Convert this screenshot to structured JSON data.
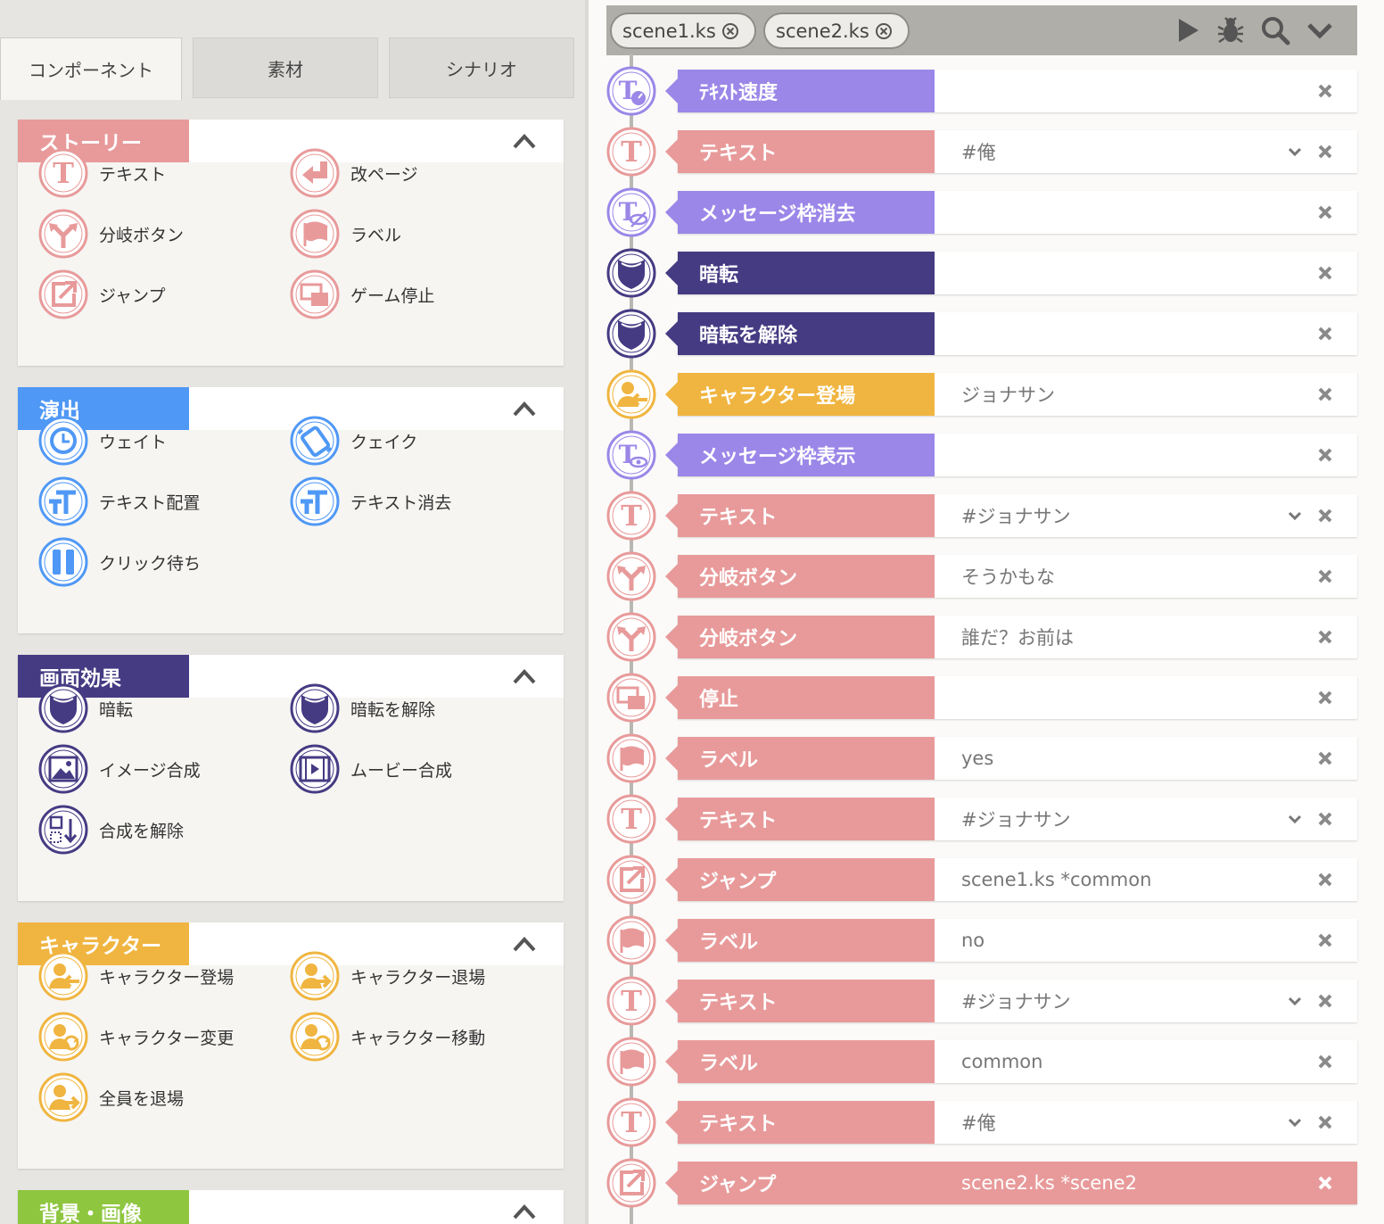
{
  "left_tabs": [
    "コンポーネント",
    "素材",
    "シナリオ"
  ],
  "panels": [
    {
      "title": "ストーリー",
      "color": "#e89a9a",
      "items": [
        {
          "label": "テキスト",
          "icon": "text-icon"
        },
        {
          "label": "改ページ",
          "icon": "return-icon"
        },
        {
          "label": "分岐ボタン",
          "icon": "branch-icon"
        },
        {
          "label": "ラベル",
          "icon": "flag-icon"
        },
        {
          "label": "ジャンプ",
          "icon": "jump-icon"
        },
        {
          "label": "ゲーム停止",
          "icon": "stop-icon"
        }
      ]
    },
    {
      "title": "演出",
      "color": "#4f98f5",
      "items": [
        {
          "label": "ウェイト",
          "icon": "clock-icon"
        },
        {
          "label": "クェイク",
          "icon": "quake-icon"
        },
        {
          "label": "テキスト配置",
          "icon": "text-position-icon"
        },
        {
          "label": "テキスト消去",
          "icon": "text-erase-icon"
        },
        {
          "label": "クリック待ち",
          "icon": "pause-icon"
        }
      ]
    },
    {
      "title": "画面効果",
      "color": "#453b83",
      "items": [
        {
          "label": "暗転",
          "icon": "fade-icon"
        },
        {
          "label": "暗転を解除",
          "icon": "fade-icon"
        },
        {
          "label": "イメージ合成",
          "icon": "image-icon"
        },
        {
          "label": "ムービー合成",
          "icon": "movie-icon"
        },
        {
          "label": "合成を解除",
          "icon": "clear-compose-icon"
        }
      ]
    },
    {
      "title": "キャラクター",
      "color": "#f0b540",
      "items": [
        {
          "label": "キャラクター登場",
          "icon": "character-enter-icon"
        },
        {
          "label": "キャラクター退場",
          "icon": "character-exit-icon"
        },
        {
          "label": "キャラクター変更",
          "icon": "character-change-icon"
        },
        {
          "label": "キャラクター移動",
          "icon": "character-move-icon"
        },
        {
          "label": "全員を退場",
          "icon": "character-exit-all-icon"
        }
      ]
    },
    {
      "title": "背景・画像",
      "color": "#8ec63f",
      "items": []
    }
  ],
  "file_tabs": [
    "scene1.ks",
    "scene2.ks"
  ],
  "toolbar_icons": [
    "play-icon",
    "bug-icon",
    "search-icon",
    "chevron-down-icon"
  ],
  "colors": {
    "story": "#e89a9a",
    "effect_purple": "#9b87e8",
    "screen_dark": "#453b83",
    "character": "#f0b540",
    "effect_blue": "#4f98f5",
    "background_green": "#8ec63f"
  },
  "rows": [
    {
      "label": "ﾃｷｽﾄ速度",
      "value": "",
      "color": "#9b87e8",
      "icon": "text-speed-icon",
      "dropdown": false
    },
    {
      "label": "テキスト",
      "value": "#俺",
      "color": "#e89a9a",
      "icon": "text-icon",
      "dropdown": true
    },
    {
      "label": "メッセージ枠消去",
      "value": "",
      "color": "#9b87e8",
      "icon": "message-hide-icon",
      "dropdown": false
    },
    {
      "label": "暗転",
      "value": "",
      "color": "#453b83",
      "icon": "fade-icon",
      "dropdown": false
    },
    {
      "label": "暗転を解除",
      "value": "",
      "color": "#453b83",
      "icon": "fade-icon",
      "dropdown": false
    },
    {
      "label": "キャラクター登場",
      "value": "ジョナサン",
      "color": "#f0b540",
      "icon": "character-enter-icon",
      "dropdown": false
    },
    {
      "label": "メッセージ枠表示",
      "value": "",
      "color": "#9b87e8",
      "icon": "message-show-icon",
      "dropdown": false
    },
    {
      "label": "テキスト",
      "value": "#ジョナサン",
      "color": "#e89a9a",
      "icon": "text-icon",
      "dropdown": true
    },
    {
      "label": "分岐ボタン",
      "value": "そうかもな",
      "color": "#e89a9a",
      "icon": "branch-icon",
      "dropdown": false
    },
    {
      "label": "分岐ボタン",
      "value": "誰だ？お前は",
      "color": "#e89a9a",
      "icon": "branch-icon",
      "dropdown": false
    },
    {
      "label": "停止",
      "value": "",
      "color": "#e89a9a",
      "icon": "stop-icon",
      "dropdown": false
    },
    {
      "label": "ラベル",
      "value": "yes",
      "color": "#e89a9a",
      "icon": "flag-icon",
      "dropdown": false
    },
    {
      "label": "テキスト",
      "value": "#ジョナサン",
      "color": "#e89a9a",
      "icon": "text-icon",
      "dropdown": true
    },
    {
      "label": "ジャンプ",
      "value": "scene1.ks *common",
      "color": "#e89a9a",
      "icon": "jump-icon",
      "dropdown": false
    },
    {
      "label": "ラベル",
      "value": "no",
      "color": "#e89a9a",
      "icon": "flag-icon",
      "dropdown": false
    },
    {
      "label": "テキスト",
      "value": "#ジョナサン",
      "color": "#e89a9a",
      "icon": "text-icon",
      "dropdown": true
    },
    {
      "label": "ラベル",
      "value": "common",
      "color": "#e89a9a",
      "icon": "flag-icon",
      "dropdown": false
    },
    {
      "label": "テキスト",
      "value": "#俺",
      "color": "#e89a9a",
      "icon": "text-icon",
      "dropdown": true
    },
    {
      "label": "ジャンプ",
      "value": "scene2.ks *scene2",
      "color": "#e89a9a",
      "icon": "jump-icon",
      "dropdown": false,
      "selected": true
    }
  ]
}
